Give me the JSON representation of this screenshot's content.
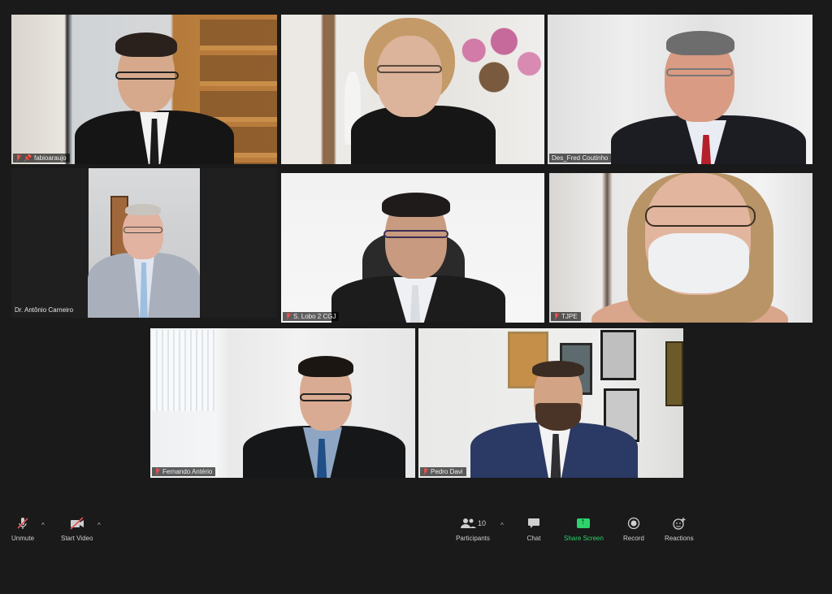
{
  "participants": [
    {
      "name": "fabioaraujo",
      "muted": true,
      "pinned": true
    },
    {
      "name": "",
      "muted": false,
      "pinned": false
    },
    {
      "name": "Des_Fred Coutinho",
      "muted": false,
      "pinned": false,
      "active_speaker": true
    },
    {
      "name": "Dr. Antônio Carneiro",
      "muted": false,
      "pinned": false
    },
    {
      "name": "S. Lobo 2 CGJ",
      "muted": true,
      "pinned": false
    },
    {
      "name": "TJPE",
      "muted": true,
      "pinned": false
    },
    {
      "name": "Fernando Antério",
      "muted": true,
      "pinned": false
    },
    {
      "name": "Pedro Davi",
      "muted": true,
      "pinned": false
    }
  ],
  "toolbar": {
    "unmute_label": "Unmute",
    "start_video_label": "Start Video",
    "participants_label": "Participants",
    "participants_count": "10",
    "chat_label": "Chat",
    "share_screen_label": "Share Screen",
    "record_label": "Record",
    "reactions_label": "Reactions"
  },
  "colors": {
    "background": "#1a1a1a",
    "active_speaker_border": "#c7e34a",
    "share_screen": "#2bd36a",
    "muted_icon": "#e35151"
  }
}
